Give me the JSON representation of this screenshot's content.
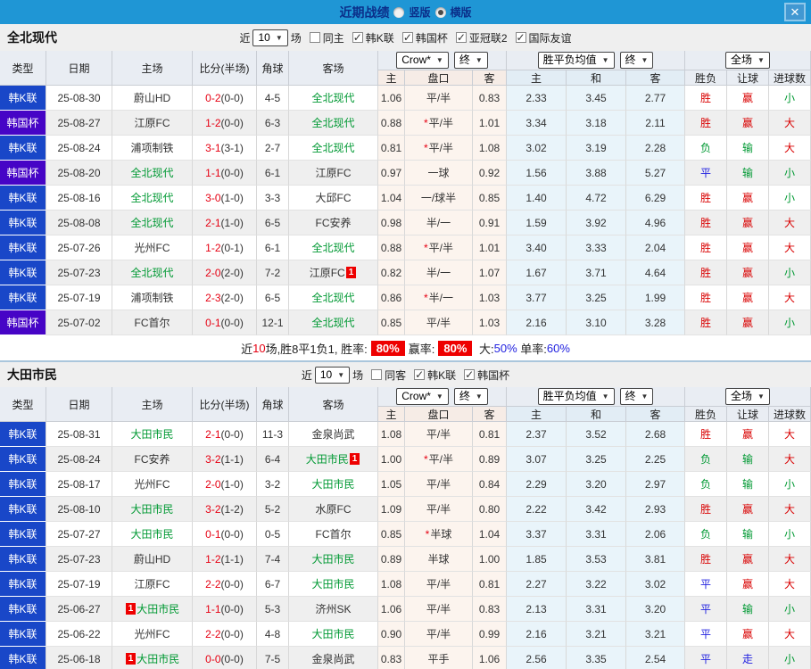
{
  "titlebar": {
    "title": "近期战绩",
    "vertical_label": "竖版",
    "vertical_checked": false,
    "horizontal_label": "横版",
    "horizontal_checked": true,
    "close_icon": "✕"
  },
  "colors": {
    "topbar": "#1f96d5",
    "title_text": "#0b2f8a",
    "league_k": "#1947c8",
    "league_cup": "#4604c6",
    "focus_team_green": "#009933",
    "score_red": "#e60012",
    "win_red": "#d90000",
    "draw_blue": "#2222e0",
    "badge_red": "#ee0000",
    "odds_col_bg": "#fcf4ee",
    "avg_col_bg": "#e9f4fa"
  },
  "league_colors": {
    "韩K联": "#1947c8",
    "韩国杯": "#4604c6"
  },
  "result_color_map": {
    "胜": "red",
    "负": "green",
    "平": "blue",
    "赢": "red",
    "输": "green",
    "走": "blue",
    "大": "red",
    "小": "green"
  },
  "table_header": {
    "type": "类型",
    "date": "日期",
    "home": "主场",
    "score": "比分(半场)",
    "corner": "角球",
    "away": "客场",
    "odds_dropdown": "Crow*",
    "final_dropdown": "终",
    "avg_dropdown": "胜平负均值",
    "full_dropdown": "全场",
    "odds_cols": [
      "主",
      "盘口",
      "客"
    ],
    "avg_cols": [
      "主",
      "和",
      "客"
    ],
    "full_cols": [
      "胜负",
      "让球",
      "进球数"
    ]
  },
  "sections": [
    {
      "team": "全北现代",
      "filter": {
        "near_label": "近",
        "count": "10",
        "matches_label": "场",
        "same_label": "同主",
        "same_checked": false,
        "leagues": [
          {
            "label": "韩K联",
            "checked": true
          },
          {
            "label": "韩国杯",
            "checked": true
          },
          {
            "label": "亚冠联2",
            "checked": true
          },
          {
            "label": "国际友谊",
            "checked": true
          }
        ]
      },
      "rows": [
        {
          "league": "韩K联",
          "date": "25-08-30",
          "home": "蔚山HD",
          "score": "0-2",
          "half": "(0-0)",
          "corner": "4-5",
          "away": "全北现代",
          "away_green": true,
          "odds_home": "1.06",
          "handicap": "平/半",
          "odds_away": "0.83",
          "avg_home": "2.33",
          "avg_draw": "3.45",
          "avg_away": "2.77",
          "result": "胜",
          "handicap_result": "赢",
          "goals_result": "小"
        },
        {
          "league": "韩国杯",
          "date": "25-08-27",
          "home": "江原FC",
          "score": "1-2",
          "half": "(0-0)",
          "corner": "6-3",
          "away": "全北现代",
          "away_green": true,
          "odds_home": "0.88",
          "handicap": "平/半",
          "handicap_star": true,
          "odds_away": "1.01",
          "avg_home": "3.34",
          "avg_draw": "3.18",
          "avg_away": "2.11",
          "result": "胜",
          "handicap_result": "赢",
          "goals_result": "大"
        },
        {
          "league": "韩K联",
          "date": "25-08-24",
          "home": "浦项制铁",
          "score": "3-1",
          "half": "(3-1)",
          "corner": "2-7",
          "away": "全北现代",
          "away_green": true,
          "odds_home": "0.81",
          "handicap": "平/半",
          "handicap_star": true,
          "odds_away": "1.08",
          "avg_home": "3.02",
          "avg_draw": "3.19",
          "avg_away": "2.28",
          "result": "负",
          "handicap_result": "输",
          "goals_result": "大"
        },
        {
          "league": "韩国杯",
          "date": "25-08-20",
          "home": "全北现代",
          "home_green": true,
          "score": "1-1",
          "half": "(0-0)",
          "corner": "6-1",
          "away": "江原FC",
          "odds_home": "0.97",
          "handicap": "一球",
          "odds_away": "0.92",
          "avg_home": "1.56",
          "avg_draw": "3.88",
          "avg_away": "5.27",
          "result": "平",
          "handicap_result": "输",
          "goals_result": "小"
        },
        {
          "league": "韩K联",
          "date": "25-08-16",
          "home": "全北现代",
          "home_green": true,
          "score": "3-0",
          "half": "(1-0)",
          "corner": "3-3",
          "away": "大邱FC",
          "odds_home": "1.04",
          "handicap": "一/球半",
          "odds_away": "0.85",
          "avg_home": "1.40",
          "avg_draw": "4.72",
          "avg_away": "6.29",
          "result": "胜",
          "handicap_result": "赢",
          "goals_result": "小"
        },
        {
          "league": "韩K联",
          "date": "25-08-08",
          "home": "全北现代",
          "home_green": true,
          "score": "2-1",
          "half": "(1-0)",
          "corner": "6-5",
          "away": "FC安养",
          "odds_home": "0.98",
          "handicap": "半/一",
          "odds_away": "0.91",
          "avg_home": "1.59",
          "avg_draw": "3.92",
          "avg_away": "4.96",
          "result": "胜",
          "handicap_result": "赢",
          "goals_result": "大"
        },
        {
          "league": "韩K联",
          "date": "25-07-26",
          "home": "光州FC",
          "score": "1-2",
          "half": "(0-1)",
          "corner": "6-1",
          "away": "全北现代",
          "away_green": true,
          "odds_home": "0.88",
          "handicap": "平/半",
          "handicap_star": true,
          "odds_away": "1.01",
          "avg_home": "3.40",
          "avg_draw": "3.33",
          "avg_away": "2.04",
          "result": "胜",
          "handicap_result": "赢",
          "goals_result": "大"
        },
        {
          "league": "韩K联",
          "date": "25-07-23",
          "home": "全北现代",
          "home_green": true,
          "score": "2-0",
          "half": "(2-0)",
          "corner": "7-2",
          "away": "江原FC",
          "away_card": "1",
          "odds_home": "0.82",
          "handicap": "半/一",
          "odds_away": "1.07",
          "avg_home": "1.67",
          "avg_draw": "3.71",
          "avg_away": "4.64",
          "result": "胜",
          "handicap_result": "赢",
          "goals_result": "小"
        },
        {
          "league": "韩K联",
          "date": "25-07-19",
          "home": "浦项制铁",
          "score": "2-3",
          "half": "(2-0)",
          "corner": "6-5",
          "away": "全北现代",
          "away_green": true,
          "odds_home": "0.86",
          "handicap": "半/一",
          "handicap_star": true,
          "odds_away": "1.03",
          "avg_home": "3.77",
          "avg_draw": "3.25",
          "avg_away": "1.99",
          "result": "胜",
          "handicap_result": "赢",
          "goals_result": "大"
        },
        {
          "league": "韩国杯",
          "date": "25-07-02",
          "home": "FC首尔",
          "score": "0-1",
          "half": "(0-0)",
          "corner": "12-1",
          "away": "全北现代",
          "away_green": true,
          "odds_home": "0.85",
          "handicap": "平/半",
          "odds_away": "1.03",
          "avg_home": "2.16",
          "avg_draw": "3.10",
          "avg_away": "3.28",
          "result": "胜",
          "handicap_result": "赢",
          "goals_result": "小"
        }
      ],
      "summary": [
        {
          "text": "近"
        },
        {
          "text": "10",
          "color": "red"
        },
        {
          "text": "场,胜8平1负1, 胜率:"
        },
        {
          "text": "80%",
          "badge": true
        },
        {
          "text": "赢率:"
        },
        {
          "text": "80%",
          "badge": true
        },
        {
          "text": " 大:"
        },
        {
          "text": "50%",
          "color": "blue"
        },
        {
          "text": " 单率:"
        },
        {
          "text": "60%",
          "color": "blue"
        }
      ]
    },
    {
      "team": "大田市民",
      "filter": {
        "near_label": "近",
        "count": "10",
        "matches_label": "场",
        "same_label": "同客",
        "same_checked": false,
        "leagues": [
          {
            "label": "韩K联",
            "checked": true
          },
          {
            "label": "韩国杯",
            "checked": true
          }
        ]
      },
      "rows": [
        {
          "league": "韩K联",
          "date": "25-08-31",
          "home": "大田市民",
          "home_green": true,
          "score": "2-1",
          "half": "(0-0)",
          "corner": "11-3",
          "away": "金泉尚武",
          "odds_home": "1.08",
          "handicap": "平/半",
          "odds_away": "0.81",
          "avg_home": "2.37",
          "avg_draw": "3.52",
          "avg_away": "2.68",
          "result": "胜",
          "handicap_result": "赢",
          "goals_result": "大"
        },
        {
          "league": "韩K联",
          "date": "25-08-24",
          "home": "FC安养",
          "score": "3-2",
          "half": "(1-1)",
          "corner": "6-4",
          "away": "大田市民",
          "away_green": true,
          "away_card": "1",
          "odds_home": "1.00",
          "handicap": "平/半",
          "handicap_star": true,
          "odds_away": "0.89",
          "avg_home": "3.07",
          "avg_draw": "3.25",
          "avg_away": "2.25",
          "result": "负",
          "handicap_result": "输",
          "goals_result": "大"
        },
        {
          "league": "韩K联",
          "date": "25-08-17",
          "home": "光州FC",
          "score": "2-0",
          "half": "(1-0)",
          "corner": "3-2",
          "away": "大田市民",
          "away_green": true,
          "odds_home": "1.05",
          "handicap": "平/半",
          "odds_away": "0.84",
          "avg_home": "2.29",
          "avg_draw": "3.20",
          "avg_away": "2.97",
          "result": "负",
          "handicap_result": "输",
          "goals_result": "小"
        },
        {
          "league": "韩K联",
          "date": "25-08-10",
          "home": "大田市民",
          "home_green": true,
          "score": "3-2",
          "half": "(1-2)",
          "corner": "5-2",
          "away": "水原FC",
          "odds_home": "1.09",
          "handicap": "平/半",
          "odds_away": "0.80",
          "avg_home": "2.22",
          "avg_draw": "3.42",
          "avg_away": "2.93",
          "result": "胜",
          "handicap_result": "赢",
          "goals_result": "大"
        },
        {
          "league": "韩K联",
          "date": "25-07-27",
          "home": "大田市民",
          "home_green": true,
          "score": "0-1",
          "half": "(0-0)",
          "corner": "0-5",
          "away": "FC首尔",
          "odds_home": "0.85",
          "handicap": "半球",
          "handicap_star": true,
          "odds_away": "1.04",
          "avg_home": "3.37",
          "avg_draw": "3.31",
          "avg_away": "2.06",
          "result": "负",
          "handicap_result": "输",
          "goals_result": "小"
        },
        {
          "league": "韩K联",
          "date": "25-07-23",
          "home": "蔚山HD",
          "score": "1-2",
          "half": "(1-1)",
          "corner": "7-4",
          "away": "大田市民",
          "away_green": true,
          "odds_home": "0.89",
          "handicap": "半球",
          "odds_away": "1.00",
          "avg_home": "1.85",
          "avg_draw": "3.53",
          "avg_away": "3.81",
          "result": "胜",
          "handicap_result": "赢",
          "goals_result": "大"
        },
        {
          "league": "韩K联",
          "date": "25-07-19",
          "home": "江原FC",
          "score": "2-2",
          "half": "(0-0)",
          "corner": "6-7",
          "away": "大田市民",
          "away_green": true,
          "odds_home": "1.08",
          "handicap": "平/半",
          "odds_away": "0.81",
          "avg_home": "2.27",
          "avg_draw": "3.22",
          "avg_away": "3.02",
          "result": "平",
          "handicap_result": "赢",
          "goals_result": "大"
        },
        {
          "league": "韩K联",
          "date": "25-06-27",
          "home": "大田市民",
          "home_green": true,
          "home_card": "1",
          "score": "1-1",
          "half": "(0-0)",
          "corner": "5-3",
          "away": "济州SK",
          "odds_home": "1.06",
          "handicap": "平/半",
          "odds_away": "0.83",
          "avg_home": "2.13",
          "avg_draw": "3.31",
          "avg_away": "3.20",
          "result": "平",
          "handicap_result": "输",
          "goals_result": "小"
        },
        {
          "league": "韩K联",
          "date": "25-06-22",
          "home": "光州FC",
          "score": "2-2",
          "half": "(0-0)",
          "corner": "4-8",
          "away": "大田市民",
          "away_green": true,
          "odds_home": "0.90",
          "handicap": "平/半",
          "odds_away": "0.99",
          "avg_home": "2.16",
          "avg_draw": "3.21",
          "avg_away": "3.21",
          "result": "平",
          "handicap_result": "赢",
          "goals_result": "大"
        },
        {
          "league": "韩K联",
          "date": "25-06-18",
          "home": "大田市民",
          "home_green": true,
          "home_card": "1",
          "score": "0-0",
          "half": "(0-0)",
          "corner": "7-5",
          "away": "金泉尚武",
          "odds_home": "0.83",
          "handicap": "平手",
          "odds_away": "1.06",
          "avg_home": "2.56",
          "avg_draw": "3.35",
          "avg_away": "2.54",
          "result": "平",
          "handicap_result": "走",
          "goals_result": "小"
        }
      ],
      "summary": null
    }
  ]
}
